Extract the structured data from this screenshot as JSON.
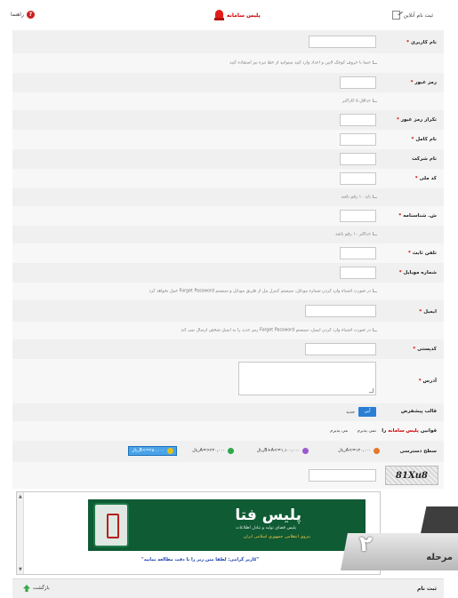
{
  "header": {
    "register_label": "ثبت نام آنلاین",
    "brand_label": "پلیس سامانه",
    "help_label": "راهنما"
  },
  "form": {
    "username": {
      "label": "نام کاربری",
      "hint": "حتما با حروف کوچک لاتین و اعداد وارد کنید میتوانید از خط تیره نیز استفاده کنید"
    },
    "password": {
      "label": "رمز عبور",
      "hint": "حداقل ۵ کاراکتر"
    },
    "password_repeat": {
      "label": "تکرار رمز عبور"
    },
    "full_name": {
      "label": "نام کامل"
    },
    "company": {
      "label": "نام شرکت"
    },
    "national_code": {
      "label": "کد ملی",
      "hint": "باید ۱۰ رقم باشد"
    },
    "id_number": {
      "label": "ش. شناسنامه",
      "hint": "حداکثر ۱۰ رقم باشد"
    },
    "phone": {
      "label": "تلفن ثابت"
    },
    "mobile": {
      "label": "شماره موبایل",
      "hint": "در صورت اشتباه وارد کردن شماره موبایل، سیستم کنترل پنل از طریق موبایل و سیستم Forget Password عمل نخواهد کرد"
    },
    "email": {
      "label": "ایمیل",
      "hint": "در صورت اشتباه وارد کردن ایمیل، سیستم Forget Password رمز جدید را به ایمیل شخص ارسال نمی کند"
    },
    "postal_code": {
      "label": "کدپستی"
    },
    "address": {
      "label": "آدرس"
    },
    "template": {
      "label": "قالب پیشفرض",
      "selected": "آبی",
      "other": "جدید"
    },
    "rules": {
      "label_prefix": "قوانین",
      "label_brand": "پلیس سامانه",
      "label_suffix": "را",
      "accept": "می پذیرم",
      "reject": "نمی پذیرم"
    },
    "access_level": {
      "label": "سطح دسترسی",
      "options": [
        {
          "text": "A<=۱۲۰,۰۰۰ریال",
          "color": "#e8772e"
        },
        {
          "text": "B+A<=۱,۱۰۰,۰۰۰ریال",
          "color": "#9b59d0"
        },
        {
          "text": "۲۴۰,۰۰۰<=Aریال",
          "color": "#2fa84a"
        },
        {
          "text": "B<=۲۵۰,۰۰۰ریال",
          "color": "#e3c21a",
          "selected": true
        }
      ]
    },
    "captcha": {
      "text": "81Xu8"
    }
  },
  "terms": {
    "banner_title": "پلیس فتا",
    "banner_sub1": "پلیس فضای تولید و تبادل اطلاعات",
    "banner_sub2": "نیروی انتظامی جمهوری اسلامی ایران",
    "note": "\"کاربر گرامی: لطفا متن زیر را با دقت مطالعه نمایید\""
  },
  "step": {
    "label": "مرحله",
    "number": "۲"
  },
  "footer": {
    "submit": "ثبت نام",
    "back": "بازگشت"
  }
}
